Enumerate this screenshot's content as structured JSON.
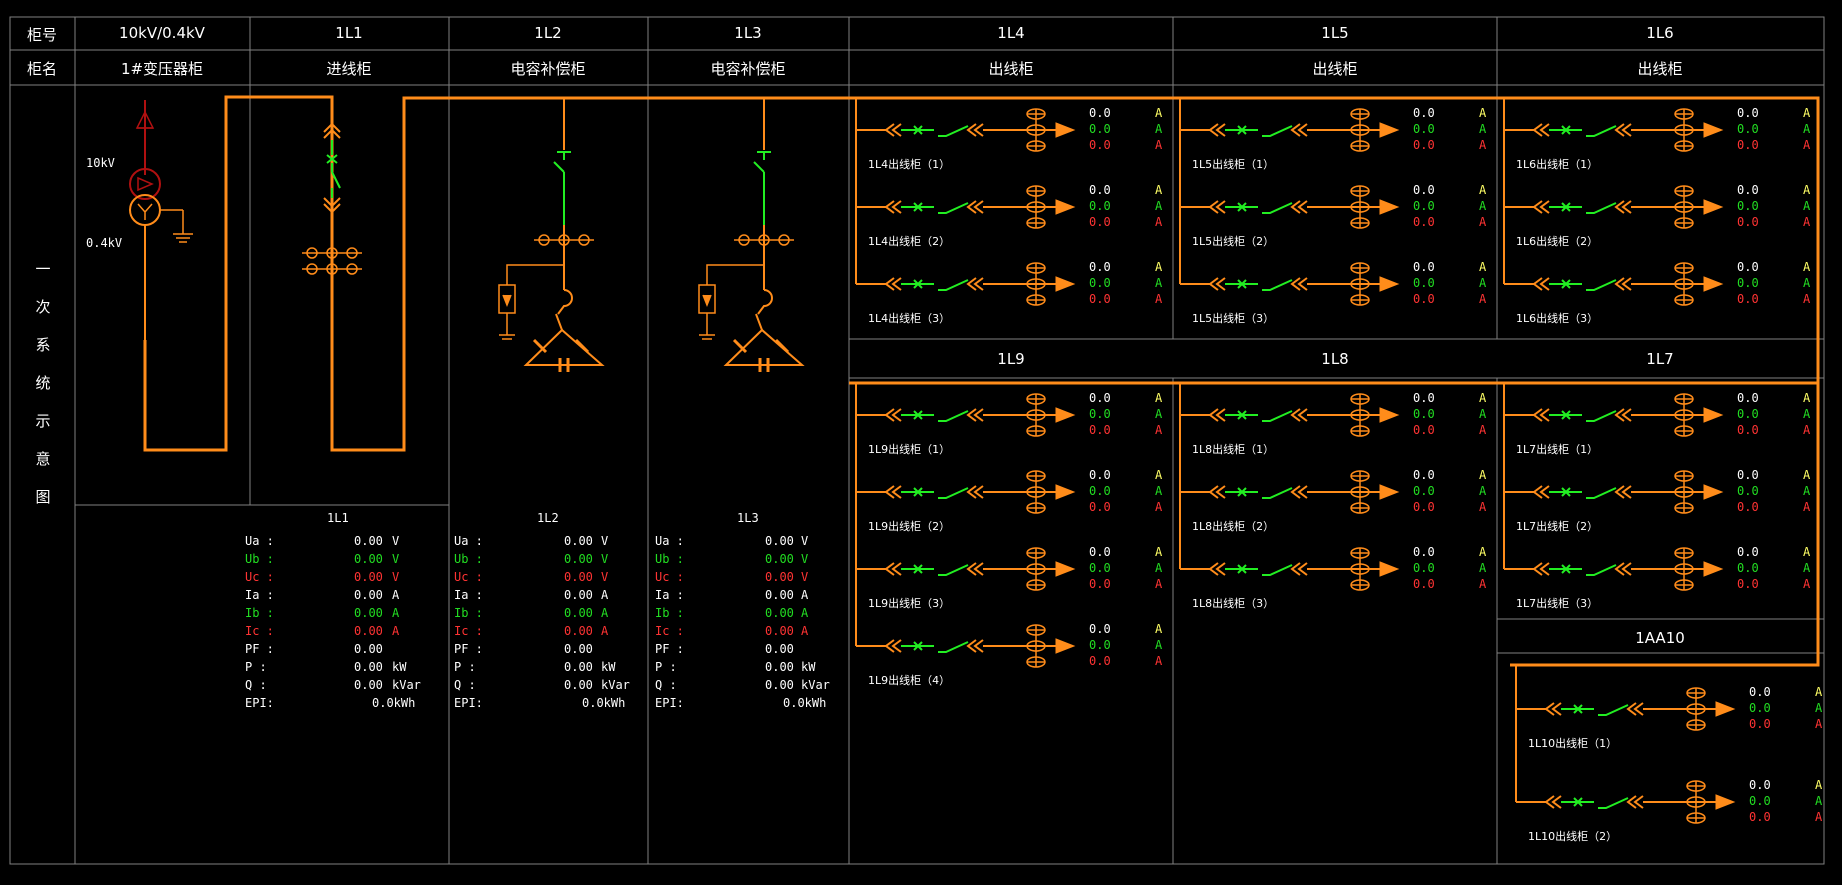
{
  "header": {
    "row1_label": "柜号",
    "row2_label": "柜名",
    "side_label": [
      "一",
      "次",
      "系",
      "统",
      "示",
      "意",
      "图"
    ]
  },
  "cabinets": [
    {
      "no": "10kV/0.4kV",
      "name": "1#变压器柜"
    },
    {
      "no": "1L1",
      "name": "进线柜"
    },
    {
      "no": "1L2",
      "name": "电容补偿柜"
    },
    {
      "no": "1L3",
      "name": "电容补偿柜"
    },
    {
      "no": "1L4",
      "name": "出线柜"
    },
    {
      "no": "1L5",
      "name": "出线柜"
    },
    {
      "no": "1L6",
      "name": "出线柜"
    }
  ],
  "transformer": {
    "hv": "10kV",
    "lv": "0.4kV"
  },
  "meters": [
    {
      "title": "1L1"
    },
    {
      "title": "1L2"
    },
    {
      "title": "1L3"
    }
  ],
  "meter_rows": [
    {
      "label": "Ua :",
      "value": "0.00",
      "unit": "V",
      "color": "w"
    },
    {
      "label": "Ub :",
      "value": "0.00",
      "unit": "V",
      "color": "g"
    },
    {
      "label": "Uc :",
      "value": "0.00",
      "unit": "V",
      "color": "r"
    },
    {
      "label": "Ia :",
      "value": "0.00",
      "unit": "A",
      "color": "w"
    },
    {
      "label": "Ib :",
      "value": "0.00",
      "unit": "A",
      "color": "g"
    },
    {
      "label": "Ic :",
      "value": "0.00",
      "unit": "A",
      "color": "r"
    },
    {
      "label": "PF :",
      "value": "0.00",
      "unit": "",
      "color": "w"
    },
    {
      "label": "P  :",
      "value": "0.00",
      "unit": "kW",
      "color": "w"
    },
    {
      "label": "Q  :",
      "value": "0.00",
      "unit": "kVar",
      "color": "w"
    },
    {
      "label": "EPI:",
      "value": "0.0kWh",
      "unit": "",
      "color": "w"
    }
  ],
  "panels": [
    {
      "id": "1L4",
      "title": "1L4",
      "feeders": [
        "1L4出线柜（1）",
        "1L4出线柜（2）",
        "1L4出线柜（3）"
      ]
    },
    {
      "id": "1L5",
      "title": "1L5",
      "feeders": [
        "1L5出线柜（1）",
        "1L5出线柜（2）",
        "1L5出线柜（3）"
      ]
    },
    {
      "id": "1L6",
      "title": "1L6",
      "feeders": [
        "1L6出线柜（1）",
        "1L6出线柜（2）",
        "1L6出线柜（3）"
      ]
    },
    {
      "id": "1L9",
      "title": "1L9",
      "feeders": [
        "1L9出线柜（1）",
        "1L9出线柜（2）",
        "1L9出线柜（3）",
        "1L9出线柜（4）"
      ]
    },
    {
      "id": "1L8",
      "title": "1L8",
      "feeders": [
        "1L8出线柜（1）",
        "1L8出线柜（2）",
        "1L8出线柜（3）"
      ]
    },
    {
      "id": "1L7",
      "title": "1L7",
      "feeders": [
        "1L7出线柜（1）",
        "1L7出线柜（2）",
        "1L7出线柜（3）"
      ]
    },
    {
      "id": "1AA10",
      "title": "1AA10",
      "feeders": [
        "1L10出线柜（1）",
        "1L10出线柜（2）"
      ]
    }
  ],
  "feeder_readout": {
    "values": [
      "0.0",
      "0.0",
      "0.0"
    ],
    "unit": "A"
  },
  "colors": {
    "bus": "#ff8c1a",
    "breaker": "#22ee22",
    "grid": "#808080",
    "phase_a": "#ffff66",
    "phase_b": "#22dd22",
    "phase_c": "#ff3333",
    "transformer_hv": "#b01010"
  }
}
